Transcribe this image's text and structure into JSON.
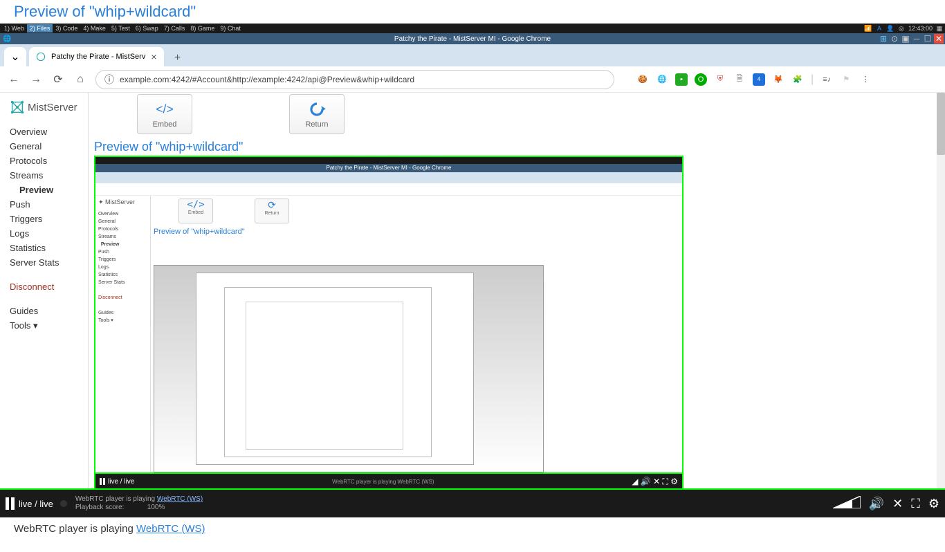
{
  "page_title": "Preview of \"whip+wildcard\"",
  "taskbar": {
    "items": [
      {
        "label": "1) Web"
      },
      {
        "label": "2) Files",
        "active": true
      },
      {
        "label": "3) Code"
      },
      {
        "label": "4) Make"
      },
      {
        "label": "5) Test"
      },
      {
        "label": "6) Swap"
      },
      {
        "label": "7) Calls"
      },
      {
        "label": "8) Game"
      },
      {
        "label": "9) Chat"
      }
    ],
    "clock": "12:43:00"
  },
  "chrome": {
    "title": "Patchy the Pirate - MistServer MI - Google Chrome",
    "tab_name": "Patchy the Pirate - MistServ",
    "url": "example.com:4242/#Account&http://example:4242/api@Preview&whip+wildcard"
  },
  "sidebar": {
    "brand": "MistServer",
    "items": [
      {
        "label": "Overview"
      },
      {
        "label": "General"
      },
      {
        "label": "Protocols"
      },
      {
        "label": "Streams"
      },
      {
        "label": "Preview",
        "active": true
      },
      {
        "label": "Push"
      },
      {
        "label": "Triggers"
      },
      {
        "label": "Logs"
      },
      {
        "label": "Statistics"
      },
      {
        "label": "Server Stats"
      }
    ],
    "disconnect": "Disconnect",
    "guides": "Guides",
    "tools": "Tools ▾"
  },
  "actions": {
    "embed": "Embed",
    "return": "Return"
  },
  "preview_heading": "Preview of \"whip+wildcard\"",
  "recur_chrome_title": "Patchy the Pirate - MistServer MI - Google Chrome",
  "recur_sidebar_brand": "MistServer",
  "recur_preview_heading": "Preview of \"whip+wildcard\"",
  "recur_live": "live / live",
  "player": {
    "live": "live / live",
    "status_prefix": "WebRTC player is playing ",
    "status_link": "WebRTC (WS)",
    "score_label": "Playback score:",
    "score_value": "100%"
  },
  "footer": {
    "prefix": "WebRTC player is playing ",
    "link": "WebRTC (WS)"
  }
}
